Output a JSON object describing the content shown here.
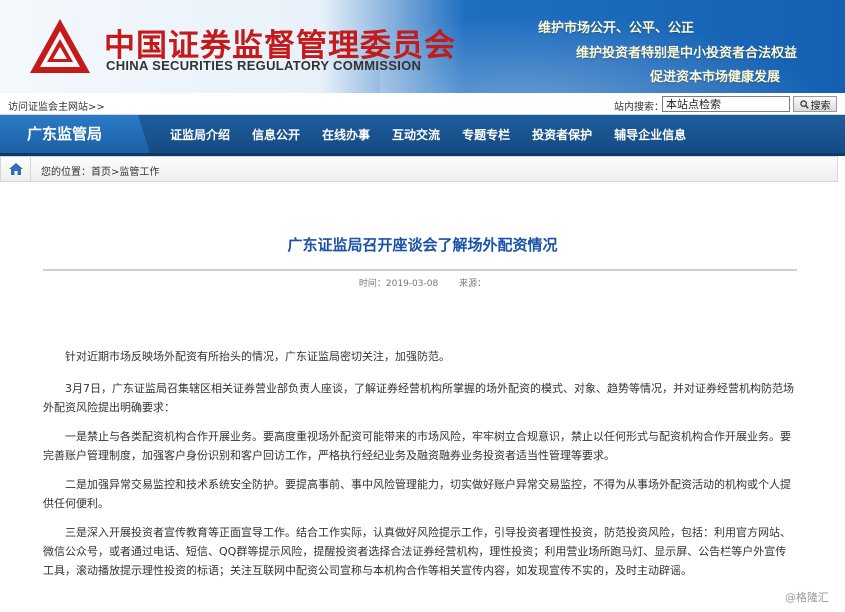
{
  "header": {
    "logo_cn": "中国证券监督管理委员会",
    "logo_en": "CHINA SECURITIES REGULATORY COMMISSION",
    "slogans": [
      "维护市场公开、公平、公正",
      "维护投资者特别是中小投资者合法权益",
      "促进资本市场健康发展"
    ]
  },
  "utility": {
    "main_site_link": "访问证监会主网站>>",
    "search_label": "站内搜索：",
    "search_value": "本站点检索",
    "search_button": "搜索"
  },
  "nav": {
    "brand": "广东监管局",
    "items": [
      "证监局介绍",
      "信息公开",
      "在线办事",
      "互动交流",
      "专题专栏",
      "投资者保护",
      "辅导企业信息"
    ]
  },
  "breadcrumb": {
    "text": "您的位置：首页>监管工作"
  },
  "article": {
    "title": "广东证监局召开座谈会了解场外配资情况",
    "time": "时间：2019-03-08",
    "source": "来源：",
    "paragraphs": [
      "针对近期市场反映场外配资有所抬头的情况，广东证监局密切关注，加强防范。",
      "3月7日，广东证监局召集辖区相关证券营业部负责人座谈，了解证券经营机构所掌握的场外配资的模式、对象、趋势等情况，并对证券经营机构防范场外配资风险提出明确要求：",
      "一是禁止与各类配资机构合作开展业务。要高度重视场外配资可能带来的市场风险，牢牢树立合规意识，禁止以任何形式与配资机构合作开展业务。要完善账户管理制度，加强客户身份识别和客户回访工作，严格执行经纪业务及融资融券业务投资者适当性管理等要求。",
      "二是加强异常交易监控和技术系统安全防护。要提高事前、事中风险管理能力，切实做好账户异常交易监控，不得为从事场外配资活动的机构或个人提供任何便利。",
      "三是深入开展投资者宣传教育等正面宣导工作。结合工作实际，认真做好风险提示工作，引导投资者理性投资，防范投资风险，包括：利用官方网站、微信公众号，或者通过电话、短信、QQ群等提示风险，提醒投资者选择合法证券经营机构，理性投资；利用营业场所跑马灯、显示屏、公告栏等户外宣传工具，滚动播放提示理性投资的标语；关注互联网中配资公司宣称与本机构合作等相关宣传内容，如发现宣传不实的，及时主动辟谣。"
    ]
  },
  "watermark": "@格隆汇",
  "colors": {
    "logo_red": "#c41a1a",
    "nav_blue": "#1d5d9c",
    "title_blue": "#1a52a8"
  }
}
